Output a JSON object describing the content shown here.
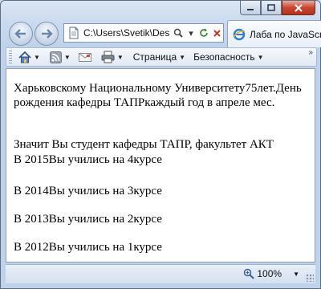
{
  "browser": {
    "address": "C:\\Users\\Svetik\\Des",
    "tab_title": "Лаба по JavaScr"
  },
  "commandbar": {
    "page_label": "Страница",
    "safety_label": "Безопасность"
  },
  "content": {
    "para1": "Харьковскому Национальному Университету75лет.День рождения кафедры ТАПРкаждый год в апреле мес.",
    "para2_line1": "Значит Вы студент кафедры ТАПР, факультет АКТ",
    "para2_line2": "В 2015Вы учились на 4курсе",
    "line3": "В 2014Вы учились на 3курсе",
    "line4": "В 2013Вы учились на 2курсе",
    "line5": "В 2012Вы учились на 1курсе"
  },
  "status": {
    "zoom": "100%"
  }
}
